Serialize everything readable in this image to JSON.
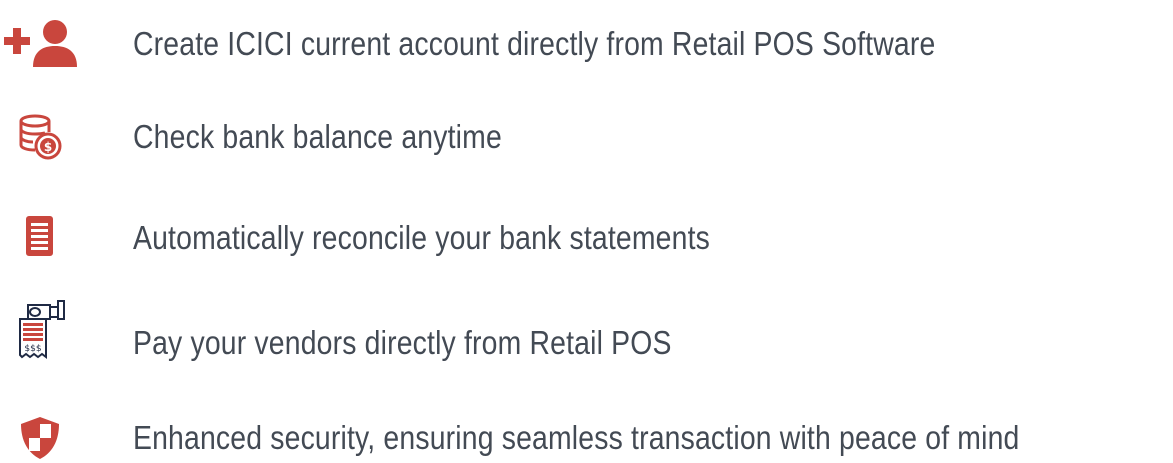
{
  "features": {
    "items": [
      {
        "icon": "add-user-icon",
        "text": "Create ICICI current account directly from Retail POS Software"
      },
      {
        "icon": "coins-icon",
        "text": "Check bank balance anytime"
      },
      {
        "icon": "document-icon",
        "text": "Automatically reconcile your bank statements"
      },
      {
        "icon": "payment-receipt-icon",
        "text": "Pay your vendors directly from Retail POS"
      },
      {
        "icon": "shield-icon",
        "text": "Enhanced security, ensuring seamless transaction with peace of mind"
      }
    ]
  },
  "colors": {
    "accent": "#c9463d",
    "text": "#434a54",
    "background": "#ffffff"
  }
}
